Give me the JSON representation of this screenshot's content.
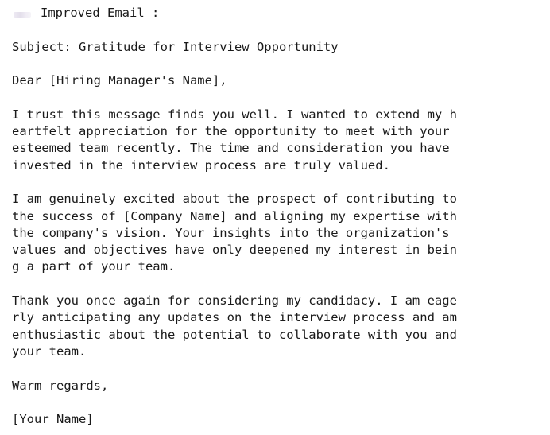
{
  "header": {
    "icon": "redacted-avatar-icon",
    "title": "Improved Email :"
  },
  "email": {
    "subject": "Subject: Gratitude for Interview Opportunity",
    "greeting": "Dear [Hiring Manager's Name],",
    "paragraph1": [
      "I trust this message finds you well. I wanted to extend my h",
      "eartfelt appreciation for the opportunity to meet with your",
      "esteemed team recently. The time and consideration you have",
      "invested in the interview process are truly valued."
    ],
    "paragraph2": [
      "I am genuinely excited about the prospect of contributing to",
      "the success of [Company Name] and aligning my expertise with",
      "the company's vision. Your insights into the organization's",
      "values and objectives have only deepened my interest in bein",
      "g a part of your team."
    ],
    "paragraph3": [
      "Thank you once again for considering my candidacy. I am eage",
      "rly anticipating any updates on the interview process and am",
      "enthusiastic about the potential to collaborate with you and",
      "your team."
    ],
    "closing": "Warm regards,",
    "signature": "[Your Name]"
  }
}
